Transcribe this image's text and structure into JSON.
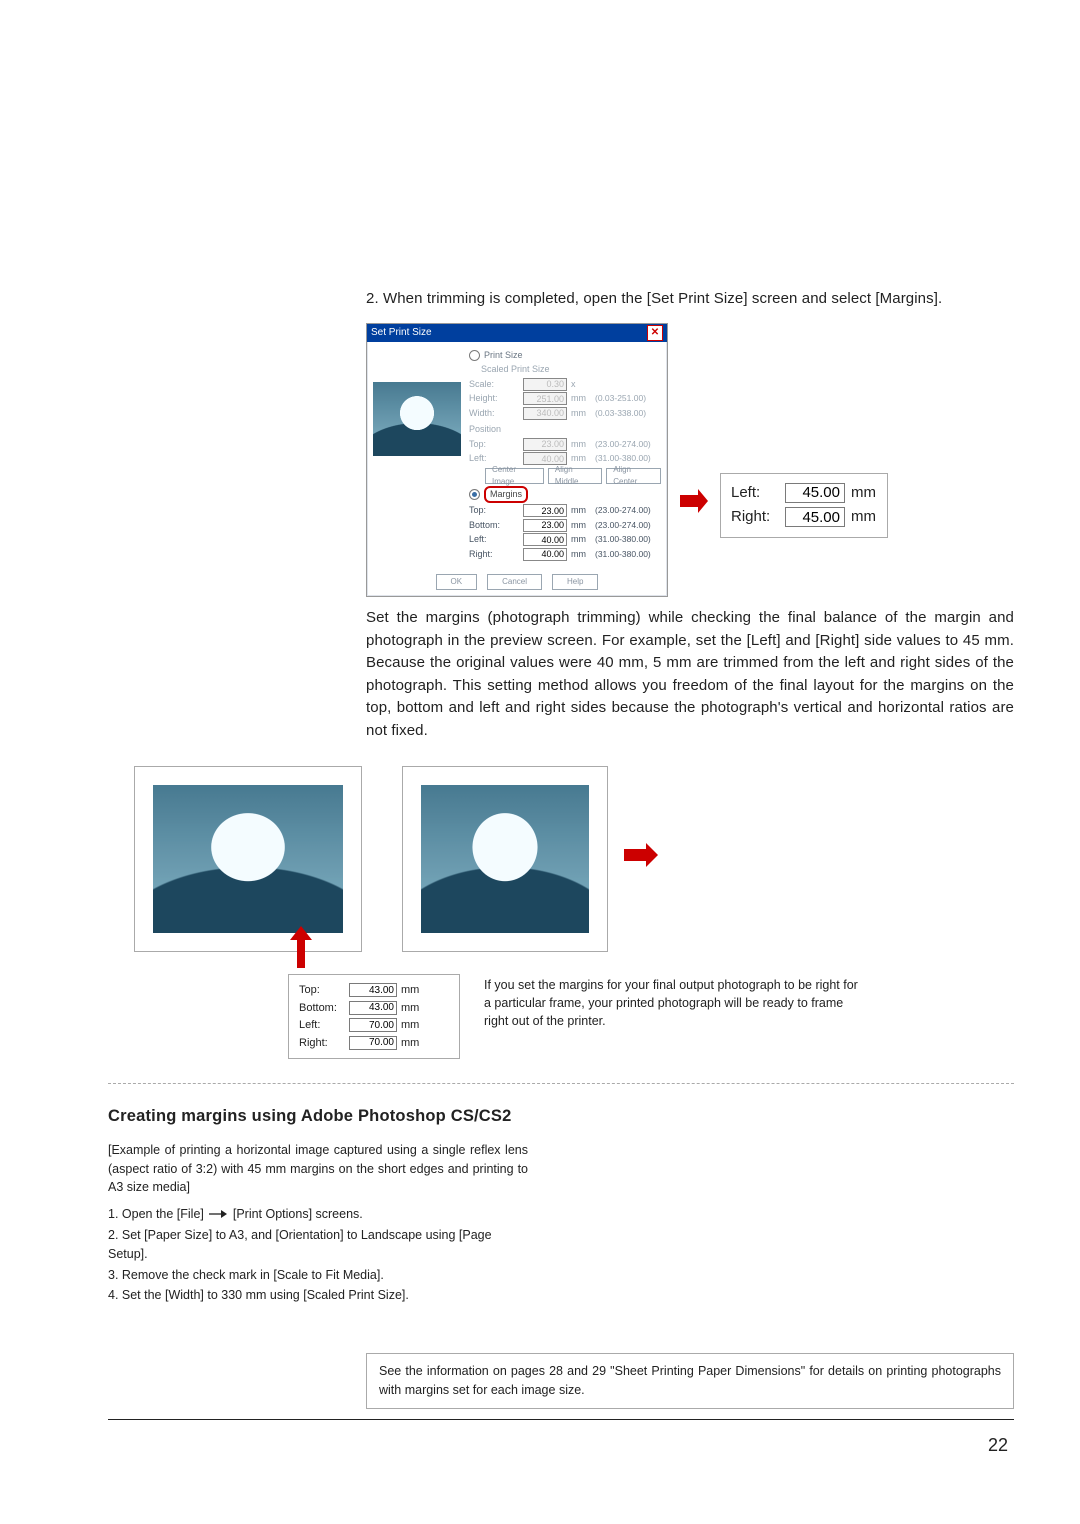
{
  "intro": "2. When trimming is completed, open the [Set Print Size] screen and select [Margins].",
  "dialog": {
    "title": "Set Print Size",
    "radio_print_size": "Print Size",
    "scaled_print_size": "Scaled Print Size",
    "scale": {
      "label": "Scale:",
      "value": "0.30",
      "unit": "x"
    },
    "height": {
      "label": "Height:",
      "value": "251.00",
      "unit": "mm",
      "range": "(0.03-251.00)"
    },
    "width": {
      "label": "Width:",
      "value": "340.00",
      "unit": "mm",
      "range": "(0.03-338.00)"
    },
    "position_label": "Position",
    "top": {
      "label": "Top:",
      "value": "23.00",
      "unit": "mm",
      "range": "(23.00-274.00)"
    },
    "left": {
      "label": "Left:",
      "value": "40.00",
      "unit": "mm",
      "range": "(31.00-380.00)"
    },
    "btn_center": "Center Image",
    "btn_middle": "Align Middle",
    "btn_aligncenter": "Align Center",
    "margins_label": "Margins",
    "m_top": {
      "label": "Top:",
      "value": "23.00",
      "unit": "mm",
      "range": "(23.00-274.00)"
    },
    "m_bottom": {
      "label": "Bottom:",
      "value": "23.00",
      "unit": "mm",
      "range": "(23.00-274.00)"
    },
    "m_left": {
      "label": "Left:",
      "value": "40.00",
      "unit": "mm",
      "range": "(31.00-380.00)"
    },
    "m_right": {
      "label": "Right:",
      "value": "40.00",
      "unit": "mm",
      "range": "(31.00-380.00)"
    },
    "ok": "OK",
    "cancel": "Cancel",
    "help": "Help"
  },
  "callout": {
    "left": {
      "label": "Left:",
      "value": "45.00",
      "unit": "mm"
    },
    "right": {
      "label": "Right:",
      "value": "45.00",
      "unit": "mm"
    }
  },
  "bodyPara": "Set the margins (photograph trimming) while checking the final balance of the margin and photograph in the preview screen. For example, set the [Left] and [Right] side values to 45 mm. Because the original values were 40 mm, 5 mm are trimmed from the left and right sides of the photograph. This setting method allows you freedom of the final layout for the margins on the top, bottom and left and right sides because the photograph's vertical and horizontal ratios are not fixed.",
  "smallMargins": {
    "top": {
      "label": "Top:",
      "value": "43.00",
      "unit": "mm"
    },
    "bottom": {
      "label": "Bottom:",
      "value": "43.00",
      "unit": "mm"
    },
    "left": {
      "label": "Left:",
      "value": "70.00",
      "unit": "mm"
    },
    "right": {
      "label": "Right:",
      "value": "70.00",
      "unit": "mm"
    }
  },
  "tip": "If you set the margins for your final output photograph to be right for a particular frame, your printed photograph will be ready to frame right out of the printer.",
  "cs": {
    "heading": "Creating margins using Adobe Photoshop CS/CS2",
    "example": "[Example of printing a horizontal image captured using a single reflex lens (aspect ratio of 3:2) with 45 mm margins on the short edges and printing to A3 size media]",
    "step1a": "1. Open the [File] ",
    "step1b": " [Print Options] screens.",
    "step2": "2. Set [Paper Size] to A3, and [Orientation] to Landscape using [Page Setup].",
    "step3": "3. Remove the check mark in [Scale to Fit Media].",
    "step4": "4. Set the [Width] to 330 mm using [Scaled Print Size]."
  },
  "info": "See the information on pages 28 and 29 \"Sheet Printing Paper Dimensions\" for details on printing photographs with margins set for each image size.",
  "pageNo": "22"
}
